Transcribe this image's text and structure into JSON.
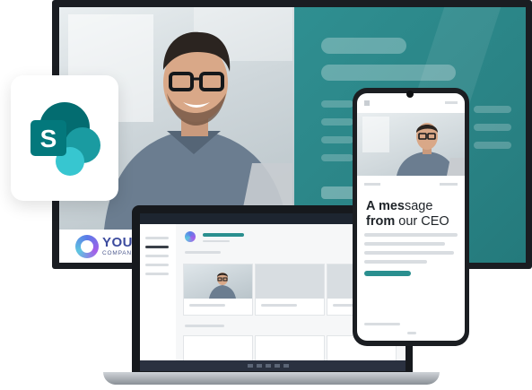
{
  "brand_logo": {
    "line1": "YOUR",
    "line2": "COMPANY"
  },
  "app_icon": {
    "name": "sharepoint-icon",
    "letter": "S",
    "colors": [
      "#036c70",
      "#1a9ba1",
      "#37c6d0"
    ]
  },
  "phone": {
    "headline_line1_bold": "A mes",
    "headline_line1_rest": "sage",
    "headline_line2_bold": "from",
    "headline_line2_rest": " our CEO"
  },
  "colors": {
    "accent_teal": "#2a8385",
    "cta": "#2a8f8f",
    "logo_text": "#3c4b9e"
  }
}
